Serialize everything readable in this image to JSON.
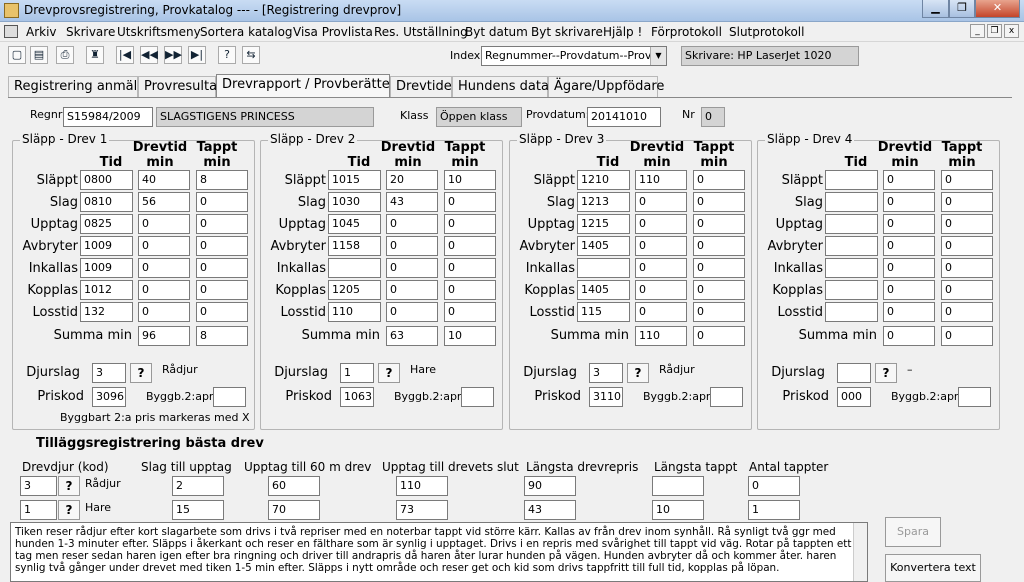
{
  "window": {
    "title": "Drevprovsregistrering, Provkatalog  --- - [Registrering drevprov]",
    "min": "▁",
    "max": "❐",
    "close": "✕"
  },
  "menu": [
    "Arkiv",
    "Skrivare",
    "Utskriftsmeny",
    "Sortera katalog",
    "Visa Provlista",
    "Res. Utställning",
    "Byt datum",
    "Byt skrivare",
    "Hjälp !",
    "Förprotokoll",
    "Slutprotokoll"
  ],
  "mdi_buttons": [
    "_",
    "❐",
    "x"
  ],
  "toolbar": {
    "index_label": "Index",
    "index_value": "Regnummer--Provdatum--Provnr",
    "printer": "Skrivare: HP LaserJet 1020",
    "buttons": [
      "▢",
      "▤",
      "⎙",
      "♜",
      "|◀",
      "◀◀",
      "▶▶",
      "▶|",
      "?",
      "⇆"
    ]
  },
  "tabs": [
    "Registrering anmälan",
    "Provresultat",
    "Drevrapport / Provberättelse",
    "Drevtider",
    "Hundens data",
    "Ägare/Uppfödare"
  ],
  "header": {
    "regnr_label": "Regnr:",
    "regnr": "S15984/2009",
    "name": "SLAGSTIGENS PRINCESS",
    "klass_label": "Klass",
    "klass": "Öppen klass",
    "provdatum_label": "Provdatum:",
    "provdatum": "20141010",
    "nr_label": "Nr",
    "nr": "0"
  },
  "col_headers": {
    "tid": "Tid",
    "drevtid": "Drevtid",
    "min": "min",
    "tappt": "Tappt"
  },
  "row_labels": [
    "Släppt",
    "Slag",
    "Upptag",
    "Avbryter",
    "Inkallas",
    "Kopplas",
    "Losstid"
  ],
  "summa_label": "Summa min",
  "djurslag_label": "Djurslag",
  "priskod_label": "Priskod",
  "byggb_label": "Byggb.2:apr",
  "q": "?",
  "byggbart_note": "Byggbart 2:a pris markeras med X",
  "drev": [
    {
      "title": "Släpp - Drev 1",
      "rows": [
        [
          "0800",
          "40",
          "8"
        ],
        [
          "0810",
          "56",
          "0"
        ],
        [
          "0825",
          "0",
          "0"
        ],
        [
          "1009",
          "0",
          "0"
        ],
        [
          "1009",
          "0",
          "0"
        ],
        [
          "1012",
          "0",
          "0"
        ],
        [
          "132",
          "0",
          "0"
        ]
      ],
      "summa": [
        "96",
        "8"
      ],
      "djurslag": "3",
      "djurtyp": "Rådjur",
      "priskod": "3096",
      "byggb": ""
    },
    {
      "title": "Släpp - Drev 2",
      "rows": [
        [
          "1015",
          "20",
          "10"
        ],
        [
          "1030",
          "43",
          "0"
        ],
        [
          "1045",
          "0",
          "0"
        ],
        [
          "1158",
          "0",
          "0"
        ],
        [
          "",
          "0",
          "0"
        ],
        [
          "1205",
          "0",
          "0"
        ],
        [
          "110",
          "0",
          "0"
        ]
      ],
      "summa": [
        "63",
        "10"
      ],
      "djurslag": "1",
      "djurtyp": "Hare",
      "priskod": "1063",
      "byggb": ""
    },
    {
      "title": "Släpp - Drev 3",
      "rows": [
        [
          "1210",
          "110",
          "0"
        ],
        [
          "1213",
          "0",
          "0"
        ],
        [
          "1215",
          "0",
          "0"
        ],
        [
          "1405",
          "0",
          "0"
        ],
        [
          "",
          "0",
          "0"
        ],
        [
          "1405",
          "0",
          "0"
        ],
        [
          "115",
          "0",
          "0"
        ]
      ],
      "summa": [
        "110",
        "0"
      ],
      "djurslag": "3",
      "djurtyp": "Rådjur",
      "priskod": "3110",
      "byggb": ""
    },
    {
      "title": "Släpp - Drev 4",
      "rows": [
        [
          "",
          "0",
          "0"
        ],
        [
          "",
          "0",
          "0"
        ],
        [
          "",
          "0",
          "0"
        ],
        [
          "",
          "0",
          "0"
        ],
        [
          "",
          "0",
          "0"
        ],
        [
          "",
          "0",
          "0"
        ],
        [
          "",
          "0",
          "0"
        ]
      ],
      "summa": [
        "0",
        "0"
      ],
      "djurslag": "",
      "djurtyp": "–",
      "priskod": "000",
      "byggb": ""
    }
  ],
  "tillagg": {
    "title": "Tilläggsregistrering bästa drev",
    "headers": [
      "Drevdjur (kod)",
      "Slag till upptag",
      "Upptag till 60 m drev",
      "Upptag till drevets slut",
      "Längsta drevrepris",
      "Längsta tappt",
      "Antal tappter"
    ],
    "rows": [
      {
        "kod": "3",
        "djur": "Rådjur",
        "vals": [
          "2",
          "60",
          "110",
          "90",
          "",
          "0"
        ]
      },
      {
        "kod": "1",
        "djur": "Hare",
        "vals": [
          "15",
          "70",
          "73",
          "43",
          "10",
          "1"
        ]
      }
    ]
  },
  "memo_text": "Tiken reser rådjur efter kort slagarbete som drivs i två repriser med en noterbar tappt vid större kärr. Kallas av från drev inom synhåll. Rå synligt två ggr med hunden 1-3 minuter efter. Släpps i åkerkant och reser en fälthare som är synlig i upptaget. Drivs i en repris med svårighet till tappt vid väg. Rotar på tappten ett tag men reser sedan haren igen efter bra ringning och driver till andrapris då haren åter lurar hunden på vägen. Hunden avbryter då och kommer åter. haren synlig två gånger under drevet med tiken 1-5 min efter. Släpps i nytt område och reser get och kid som drivs tappfritt till full tid, kopplas på löpan.",
  "buttons": {
    "spara": "Spara",
    "konvertera": "Konvertera text"
  }
}
